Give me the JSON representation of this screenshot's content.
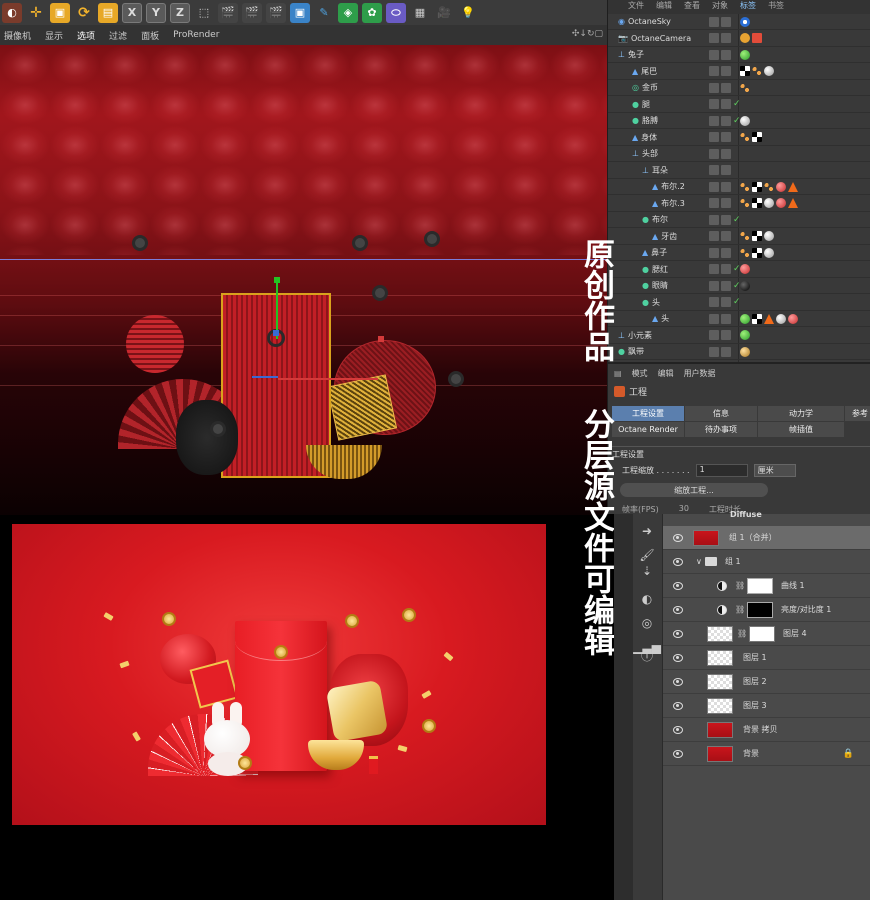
{
  "toolbar": {
    "axis_x": "X",
    "axis_y": "Y",
    "axis_z": "Z"
  },
  "viewport_menu": {
    "items": [
      "摄像机",
      "显示",
      "选项",
      "过滤",
      "面板",
      "ProRender"
    ],
    "active_index": 2
  },
  "object_manager": {
    "menu": [
      "文件",
      "编辑",
      "查看",
      "对象",
      "标签",
      "书签"
    ],
    "active_menu": "标签",
    "objects": [
      {
        "name": "OctaneSky",
        "check": "",
        "tags": [
          "octane-sky-tag"
        ]
      },
      {
        "name": "OctaneCamera",
        "check": "",
        "tags": [
          "camera-tag-a",
          "camera-tag-b"
        ]
      },
      {
        "name": "兔子",
        "check": "",
        "tags": [
          "green-material-ball"
        ]
      },
      {
        "name": "尾巴",
        "check": "",
        "tags": [
          "checker-tag",
          "orange-dots",
          "grey-material-ball"
        ]
      },
      {
        "name": "金币",
        "check": "",
        "tags": [
          "orange-dots"
        ]
      },
      {
        "name": "腿",
        "check": "✓",
        "tags": []
      },
      {
        "name": "胳膊",
        "check": "✓",
        "tags": [
          "grey-material-ball"
        ]
      },
      {
        "name": "身体",
        "check": "",
        "tags": [
          "orange-dots",
          "checker-tag"
        ]
      },
      {
        "name": "头部",
        "check": "",
        "tags": []
      },
      {
        "name": "耳朵",
        "check": "",
        "tags": []
      },
      {
        "name": "布尔.2",
        "check": "",
        "tags": [
          "orange-dots",
          "checker-tag",
          "orange-dots",
          "red-material-ball",
          "orange-triangle"
        ]
      },
      {
        "name": "布尔.3",
        "check": "",
        "tags": [
          "orange-dots",
          "checker-tag",
          "grey-material-ball",
          "red-material-ball",
          "orange-triangle"
        ]
      },
      {
        "name": "布尔",
        "check": "✓",
        "tags": []
      },
      {
        "name": "牙齿",
        "check": "",
        "tags": [
          "orange-dots",
          "checker-tag",
          "grey-material-ball"
        ]
      },
      {
        "name": "鼻子",
        "check": "",
        "tags": [
          "orange-dots",
          "checker-tag",
          "grey-material-ball"
        ]
      },
      {
        "name": "腮红",
        "check": "✓",
        "tags": [
          "red-material-ball"
        ]
      },
      {
        "name": "眼睛",
        "check": "✓",
        "tags": [
          "dark-material-ball"
        ]
      },
      {
        "name": "头",
        "check": "✓",
        "tags": []
      },
      {
        "name": "头",
        "check": "",
        "tags": [
          "green-material-ball",
          "checker-tag",
          "orange-triangle",
          "grey-material-ball",
          "red-material-ball"
        ]
      },
      {
        "name": "小元素",
        "check": "",
        "tags": [
          "green-material-ball"
        ]
      },
      {
        "name": "飘带",
        "check": "",
        "tags": [
          "gold-material-ball"
        ]
      }
    ]
  },
  "attributes": {
    "menu": [
      "模式",
      "编辑",
      "用户数据"
    ],
    "title": "工程",
    "tabs": [
      "工程设置",
      "信息",
      "动力学",
      "参考",
      "Octane Render",
      "待办事项",
      "帧插值"
    ],
    "active_tab": "工程设置",
    "section": "工程设置",
    "scale_label": "工程缩放 . . . . . . .",
    "scale_value": "1",
    "unit": "厘米",
    "scale_button": "缩放工程...",
    "bottom_left": "帧率(FPS)",
    "bottom_mid": "30",
    "bottom_right": "工程时长"
  },
  "caption": {
    "line1": "原创作品",
    "line2": "分层源文件可编辑"
  },
  "layers": {
    "header_partial": "Diffuse",
    "rows": [
      {
        "name": "组 1（合并）",
        "thumb": "red",
        "selected": true
      },
      {
        "name": "组 1",
        "thumb": "folder",
        "selected": false
      },
      {
        "name": "曲线 1",
        "thumb": "curves",
        "selected": false
      },
      {
        "name": "亮度/对比度 1",
        "thumb": "mask-black",
        "selected": false
      },
      {
        "name": "图层 4",
        "thumb": "white",
        "selected": false
      },
      {
        "name": "图层 1",
        "thumb": "checker",
        "selected": false
      },
      {
        "name": "图层 2",
        "thumb": "checker",
        "selected": false
      },
      {
        "name": "图层 3",
        "thumb": "checker",
        "selected": false
      },
      {
        "name": "背景 拷贝",
        "thumb": "red",
        "selected": false
      },
      {
        "name": "背景",
        "thumb": "red",
        "selected": false
      }
    ]
  },
  "colors": {
    "render_red": "#d81a20",
    "accent_blue": "#5b7fae",
    "gold": "#e1a93b"
  }
}
